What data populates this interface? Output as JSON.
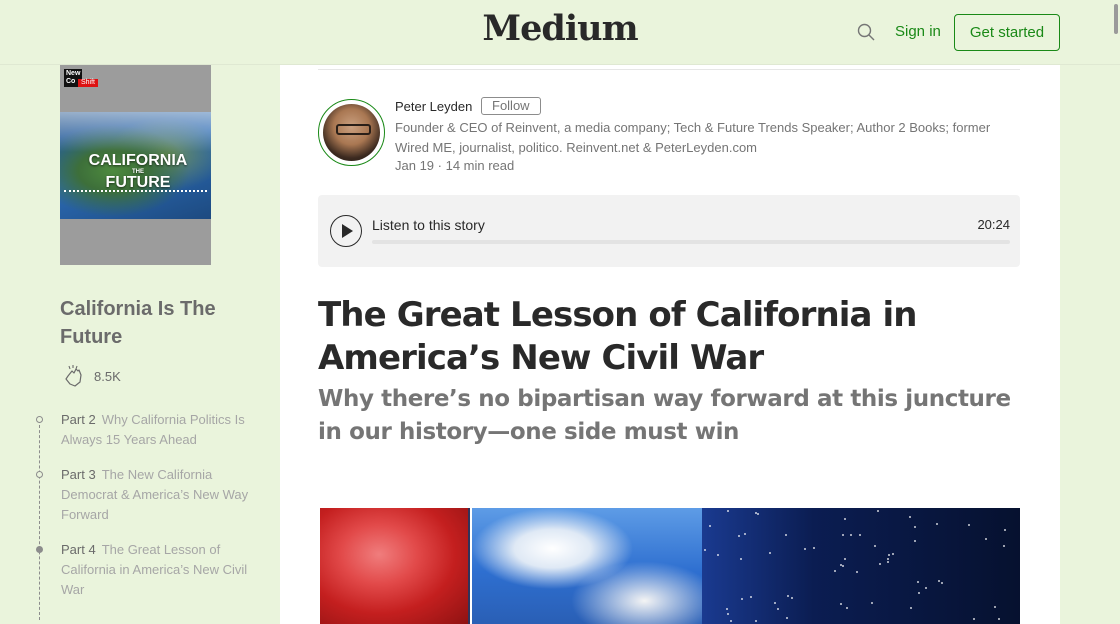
{
  "header": {
    "logo": "Medium",
    "sign_in": "Sign in",
    "get_started": "Get started"
  },
  "sidebar": {
    "cover": {
      "brand_line1": "New",
      "brand_line2": "Co",
      "tag": "Shift",
      "title_line1": "CALIFORNIA",
      "title_line2": "THE",
      "title_line3": "FUTURE"
    },
    "series_title": "California Is The Future",
    "claps": "8.5K",
    "parts": [
      {
        "num": "Part 2",
        "title": "Why California Politics Is Always 15 Years Ahead",
        "active": false
      },
      {
        "num": "Part 3",
        "title": "The New California Democrat & America’s New Way Forward",
        "active": false
      },
      {
        "num": "Part 4",
        "title": "The Great Lesson of California in America’s New Civil War",
        "active": true
      }
    ]
  },
  "article": {
    "author": {
      "name": "Peter Leyden",
      "follow": "Follow",
      "bio": "Founder & CEO of Reinvent, a media company; Tech & Future Trends Speaker; Author 2 Books; former Wired ME, journalist, politico. Reinvent.net & PeterLeyden.com",
      "meta": "Jan 19 · 14 min read"
    },
    "player": {
      "label": "Listen to this story",
      "duration": "20:24",
      "progress": 0
    },
    "title": "The Great Lesson of California in America’s New Civil War",
    "subtitle": "Why there’s no bipartisan way forward at this juncture in our history—one side must win"
  },
  "colors": {
    "background": "#eaf4dc",
    "accent": "#1a8917",
    "text": "#292929",
    "muted": "#757575"
  }
}
